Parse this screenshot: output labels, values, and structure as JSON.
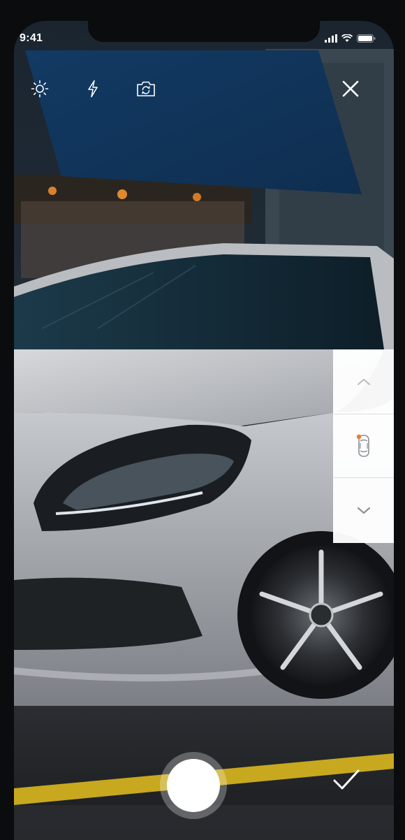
{
  "status_bar": {
    "time": "9:41",
    "signal_icon": "cellular-signal-icon",
    "wifi_icon": "wifi-icon",
    "battery_icon": "battery-icon"
  },
  "toolbar": {
    "brightness_icon": "brightness-icon",
    "flash_icon": "flash-icon",
    "switch_camera_icon": "switch-camera-icon",
    "close_icon": "close-icon"
  },
  "angle_selector": {
    "up_icon": "chevron-up-icon",
    "current_view_icon": "car-top-view-icon",
    "down_icon": "chevron-down-icon",
    "indicator_color": "#f07a2a"
  },
  "capture": {
    "shutter_icon": "shutter-button",
    "confirm_icon": "checkmark-icon"
  },
  "colors": {
    "accent": "#f07a2a",
    "panel": "#ffffff",
    "icon_light": "#ffffff",
    "icon_muted": "#b7bcc3"
  }
}
